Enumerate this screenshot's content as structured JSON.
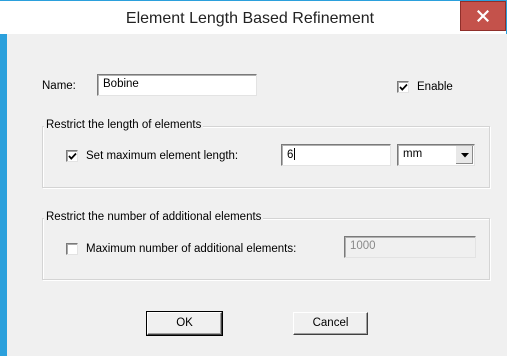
{
  "window": {
    "title": "Element Length Based Refinement",
    "close_glyph": "x",
    "title_bar_border_color": "#2ba0dc",
    "close_button_color": "#c4524b"
  },
  "name_row": {
    "label": "Name:",
    "value": "Bobine",
    "enable_label": "Enable",
    "enable_checked": true
  },
  "length_group": {
    "legend": "Restrict the length of elements",
    "checkbox_label": "Set maximum element length:",
    "checked": true,
    "value": "6",
    "unit": "mm"
  },
  "number_group": {
    "legend": "Restrict the number of additional elements",
    "checkbox_label": "Maximum number of additional elements:",
    "checked": false,
    "value": "1000"
  },
  "buttons": {
    "ok": "OK",
    "cancel": "Cancel"
  },
  "icons": {
    "close": "close-icon",
    "check": "checkmark-icon",
    "dropdown": "chevron-down-icon"
  }
}
